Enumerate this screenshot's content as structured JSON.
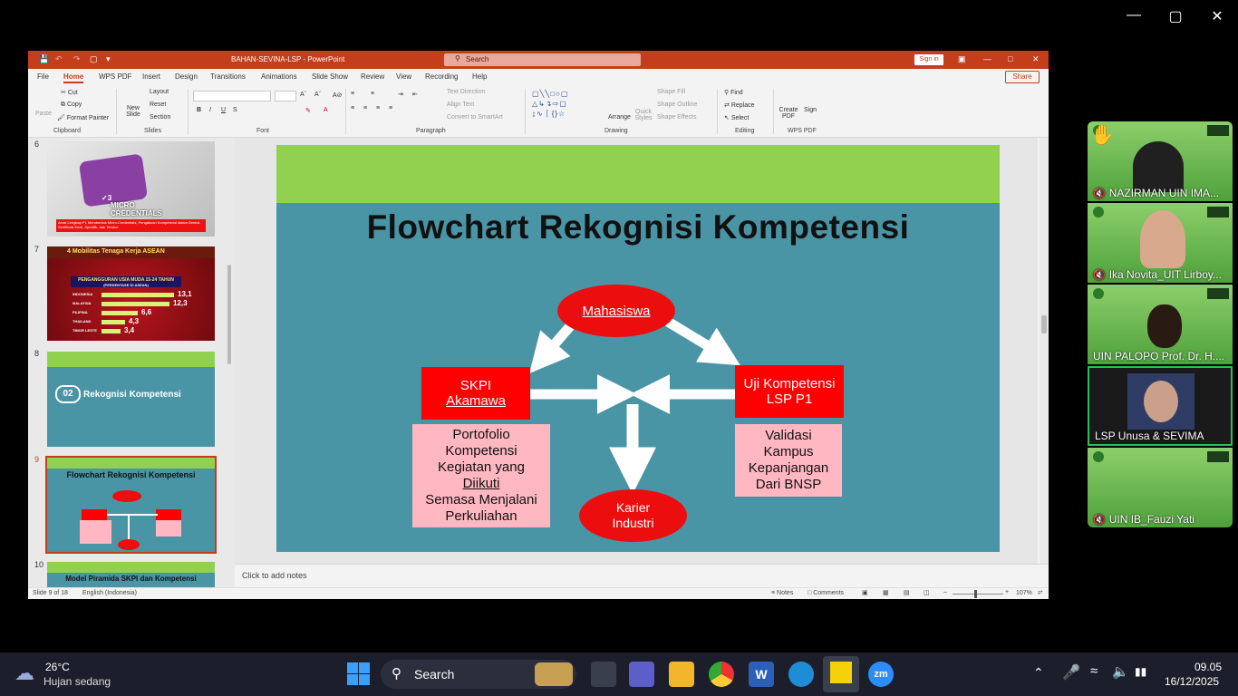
{
  "window": {
    "title": "BAHAN-SEVINA-LSP  -  PowerPoint",
    "search_placeholder": "Search",
    "signin_label": "Sign in",
    "share_label": "Share",
    "minimize_icon": "—",
    "restore_icon": "▢",
    "close_icon": "✕"
  },
  "menus": [
    "File",
    "Home",
    "WPS PDF",
    "Insert",
    "Design",
    "Transitions",
    "Animations",
    "Slide Show",
    "Review",
    "View",
    "Recording",
    "Help"
  ],
  "ribbon": {
    "clipboard": {
      "paste": "Paste",
      "cut": "Cut",
      "copy": "Copy",
      "format_painter": "Format Painter",
      "label": "Clipboard"
    },
    "slides": {
      "new_slide": "New Slide",
      "layout": "Layout",
      "reset": "Reset",
      "section": "Section",
      "label": "Slides"
    },
    "font": {
      "label": "Font",
      "bold": "B",
      "italic": "I",
      "underline": "U",
      "strike": "S"
    },
    "paragraph": {
      "text_direction": "Text Direction",
      "align_text": "Align Text",
      "convert": "Convert to SmartArt",
      "label": "Paragraph"
    },
    "drawing": {
      "arrange": "Arrange",
      "quick_styles": "Quick Styles",
      "shape_fill": "Shape Fill",
      "shape_outline": "Shape Outline",
      "shape_effects": "Shape Effects",
      "label": "Drawing"
    },
    "editing": {
      "find": "Find",
      "replace": "Replace",
      "select": "Select",
      "label": "Editing"
    },
    "wps": {
      "create_pdf": "Create PDF",
      "sign": "Sign",
      "label": "WPS PDF"
    }
  },
  "thumbnails": [
    {
      "num": "6",
      "caption": "MICRO CREDENTIALS",
      "badge": "3",
      "footer": "Amat Lengkap P1 Membentuk Micro-Credentials; Pengakuan Kompetensi dalam Bentuk Sertifikasi Kecil, Spesifik, dan Terukur"
    },
    {
      "num": "7",
      "header": "4 Mobilitas Tenaga Kerja ASEAN",
      "subtitle": "PENGANGGURAN USIA MUDA 15-24 TAHUN",
      "subsub": "(PERSENTASE DI ASEAN)",
      "rows": [
        {
          "label": "INDONESIA",
          "value": 13.1,
          "text": "13,1"
        },
        {
          "label": "MALAYSIA",
          "value": 12.3,
          "text": "12,3"
        },
        {
          "label": "FILIPINA",
          "value": 6.6,
          "text": "6,6"
        },
        {
          "label": "THAILAND",
          "value": 4.3,
          "text": "4,3"
        },
        {
          "label": "TIMOR LESTE",
          "value": 3.4,
          "text": "3,4"
        }
      ]
    },
    {
      "num": "8",
      "badge": "02",
      "title": "Rekognisi Kompetensi"
    },
    {
      "num": "9",
      "title": "Flowchart Rekognisi Kompetensi"
    },
    {
      "num": "10",
      "title": "Model Piramida SKPI dan Kompetensi"
    }
  ],
  "slide": {
    "title": "Flowchart Rekognisi Kompetensi",
    "node_top": "Mahasiswa",
    "node_left_line1": "SKPI",
    "node_left_line2": "Akamawa",
    "node_right_line1": "Uji Kompetensi",
    "node_right_line2": "LSP P1",
    "node_bottom_line1": "Karier",
    "node_bottom_line2": "Industri",
    "left_note": [
      "Portofolio",
      "Kompetensi",
      "Kegiatan yang",
      "Diikuti",
      "Semasa Menjalani",
      "Perkuliahan"
    ],
    "right_note": [
      "Validasi",
      "Kampus",
      "Kepanjangan",
      "Dari BNSP"
    ],
    "colors": {
      "bg": "#4995a5",
      "band": "#92d050",
      "red": "#ec0e0e",
      "box_red": "#ff0000",
      "pink": "#ffb7c2"
    }
  },
  "notes_placeholder": "Click to add notes",
  "status": {
    "slide": "Slide 9 of 18",
    "language": "English (Indonesia)",
    "notes": "Notes",
    "comments": "Comments",
    "zoom": "107%"
  },
  "participants": [
    {
      "name": "NAZIRMAN UIN IMA...",
      "muted": true,
      "hand": true
    },
    {
      "name": "Ika Novita_UIT Lirboy...",
      "muted": true
    },
    {
      "name": "UIN PALOPO Prof. Dr. H....",
      "muted": false
    },
    {
      "name": "LSP Unusa & SEVIMA",
      "muted": false,
      "active": true
    },
    {
      "name": "UIN IB_Fauzi Yati",
      "muted": true
    }
  ],
  "taskbar": {
    "temp": "26°C",
    "weather": "Hujan sedang",
    "search": "Search",
    "time": "09.05",
    "date": "16/12/2025"
  }
}
